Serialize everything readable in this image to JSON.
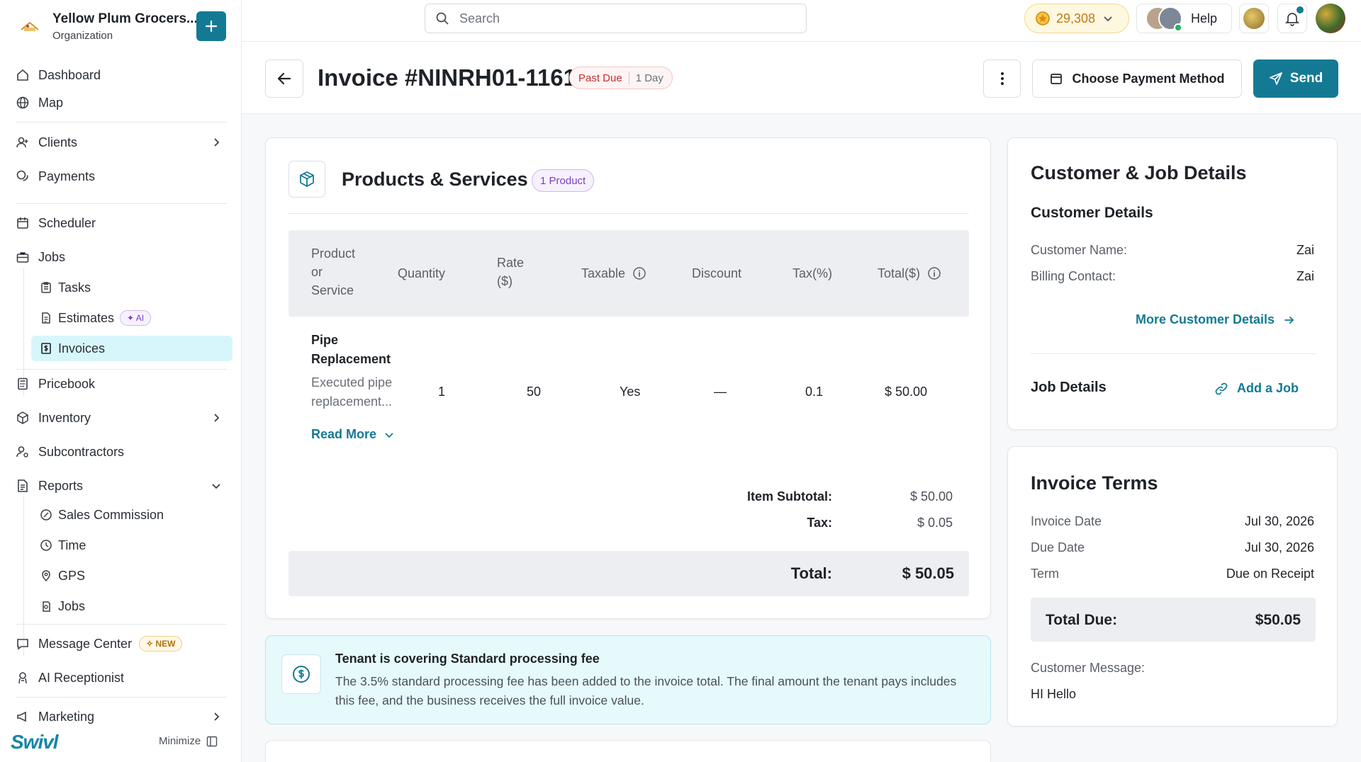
{
  "org": {
    "name": "Yellow Plum Grocers...",
    "sub": "Organization"
  },
  "nav": {
    "dashboard": "Dashboard",
    "map": "Map",
    "clients": "Clients",
    "payments": "Payments",
    "scheduler": "Scheduler",
    "jobs": "Jobs",
    "tasks": "Tasks",
    "estimates": "Estimates",
    "estimates_tag": "AI",
    "invoices": "Invoices",
    "pricebook": "Pricebook",
    "inventory": "Inventory",
    "subcontractors": "Subcontractors",
    "reports": "Reports",
    "sales_commission": "Sales Commission",
    "time": "Time",
    "gps": "GPS",
    "report_jobs": "Jobs",
    "message_center": "Message Center",
    "message_center_tag": "NEW",
    "ai_receptionist": "AI Receptionist",
    "marketing": "Marketing"
  },
  "brand": "Swivl",
  "minimize_label": "Minimize",
  "topbar": {
    "search_placeholder": "Search",
    "points": "29,308",
    "help": "Help"
  },
  "invoice": {
    "title": "Invoice #NINRH01-1161",
    "status": "Past Due",
    "status_days": "1 Day",
    "payment_button": "Choose Payment Method",
    "send_button": "Send"
  },
  "products": {
    "title": "Products & Services",
    "count": "1 Product",
    "columns": [
      "Product or Service",
      "Quantity",
      "Rate ($)",
      "Taxable",
      "Discount",
      "Tax(%)",
      "Total($)"
    ],
    "rows": [
      {
        "name": "Pipe Replacement",
        "description": "Executed pipe replacement...",
        "quantity": "1",
        "rate": "50",
        "taxable": "Yes",
        "discount": "—",
        "tax": "0.1",
        "total": "$ 50.00"
      }
    ],
    "read_more": "Read More",
    "subtotal_label": "Item Subtotal:",
    "subtotal": "$ 50.00",
    "tax_label": "Tax:",
    "tax": "$ 0.05",
    "total_label": "Total:",
    "total": "$ 50.05"
  },
  "fee": {
    "title": "Tenant is covering Standard processing fee",
    "body": "The 3.5% standard processing fee has been added to the invoice total. The final amount the tenant pays includes this fee, and the business receives the full invoice value."
  },
  "customer": {
    "title": "Customer & Job Details",
    "subtitle": "Customer Details",
    "name_label": "Customer Name:",
    "name": "Zai",
    "billing_label": "Billing Contact:",
    "billing": "Zai",
    "more_link": "More Customer Details",
    "job_title": "Job Details",
    "add_job": "Add a Job"
  },
  "terms": {
    "title": "Invoice Terms",
    "invoice_date_label": "Invoice Date",
    "invoice_date": "Jul 30, 2026",
    "due_date_label": "Due Date",
    "due_date": "Jul 30, 2026",
    "term_label": "Term",
    "term": "Due on Receipt",
    "total_due_label": "Total Due:",
    "total_due": "$50.05",
    "message_label": "Customer Message:",
    "message": "HI Hello"
  },
  "colors": {
    "accent": "#147a94",
    "past_due": "#c52d2d",
    "active_nav": "#d7f6fb",
    "ai_tag": "#7a3fc0",
    "new_tag": "#b0700f"
  }
}
